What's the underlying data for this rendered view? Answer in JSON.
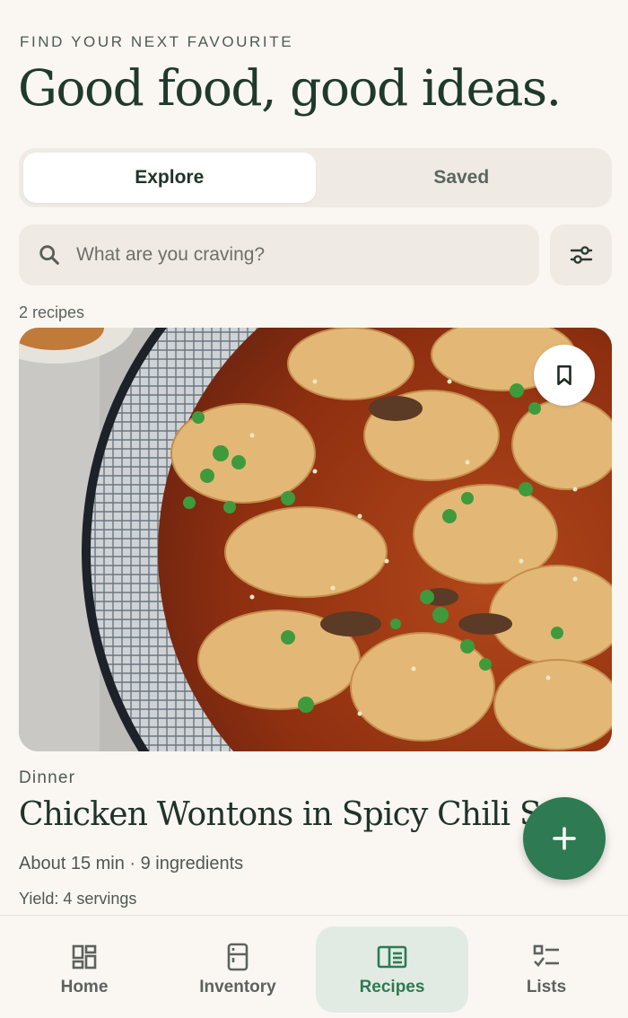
{
  "header": {
    "eyebrow": "FIND YOUR NEXT FAVOURITE",
    "title": "Good food, good ideas."
  },
  "tabs": [
    {
      "label": "Explore",
      "active": true
    },
    {
      "label": "Saved",
      "active": false
    }
  ],
  "search": {
    "placeholder": "What are you craving?",
    "value": "",
    "icon": "search-icon"
  },
  "filter": {
    "icon": "sliders-icon"
  },
  "results": {
    "count_label": "2 recipes"
  },
  "recipe": {
    "image": "chicken wontons in chili oil with green onions and sesame seeds",
    "category": "Dinner",
    "title": "Chicken Wontons in Spicy Chili Sauce",
    "meta": "About 15 min · 9 ingredients",
    "yield": "Yield: 4 servings",
    "bookmark_icon": "bookmark-icon"
  },
  "fab": {
    "icon": "plus-icon"
  },
  "nav": [
    {
      "label": "Home",
      "icon": "dashboard-icon",
      "active": false
    },
    {
      "label": "Inventory",
      "icon": "fridge-icon",
      "active": false
    },
    {
      "label": "Recipes",
      "icon": "book-icon",
      "active": true
    },
    {
      "label": "Lists",
      "icon": "checklist-icon",
      "active": false
    }
  ],
  "colors": {
    "background": "#faf7f2",
    "accent": "#2e7a52",
    "surface": "#efebe4",
    "active_nav_bg": "#e2ebe3"
  }
}
